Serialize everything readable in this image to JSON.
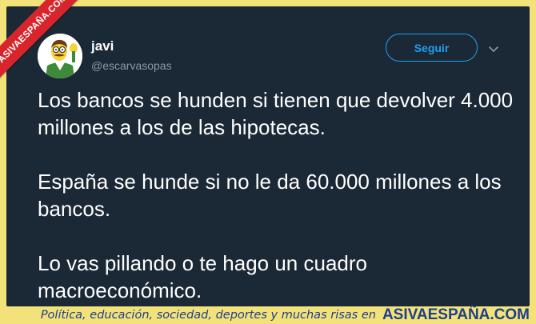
{
  "watermark": {
    "ribbon_text": "ASIVAESPAÑA.COM"
  },
  "tweet": {
    "display_name": "javi",
    "handle": "@escarvasopas",
    "follow_label": "Seguir",
    "paragraphs": [
      "Los bancos se hunden si tienen que devolver 4.000 millones a los de las hipotecas.",
      "España se hunde si no le da 60.000 millones a los bancos.",
      "Lo vas pillando o te hago un cuadro macroeconómico."
    ],
    "avatar_icon": "cartoon-character-avatar",
    "more_icon": "chevron-down-icon"
  },
  "footer": {
    "tagline": "Política, educación, sociedad, deportes y muchas risas en",
    "brand": "ASIVAESPAÑA.COM"
  },
  "colors": {
    "background": "#f3e27a",
    "card": "#1b2836",
    "accent": "#1da1f2",
    "ribbon": "#d6262c",
    "footer_text": "#1e3f8a"
  }
}
